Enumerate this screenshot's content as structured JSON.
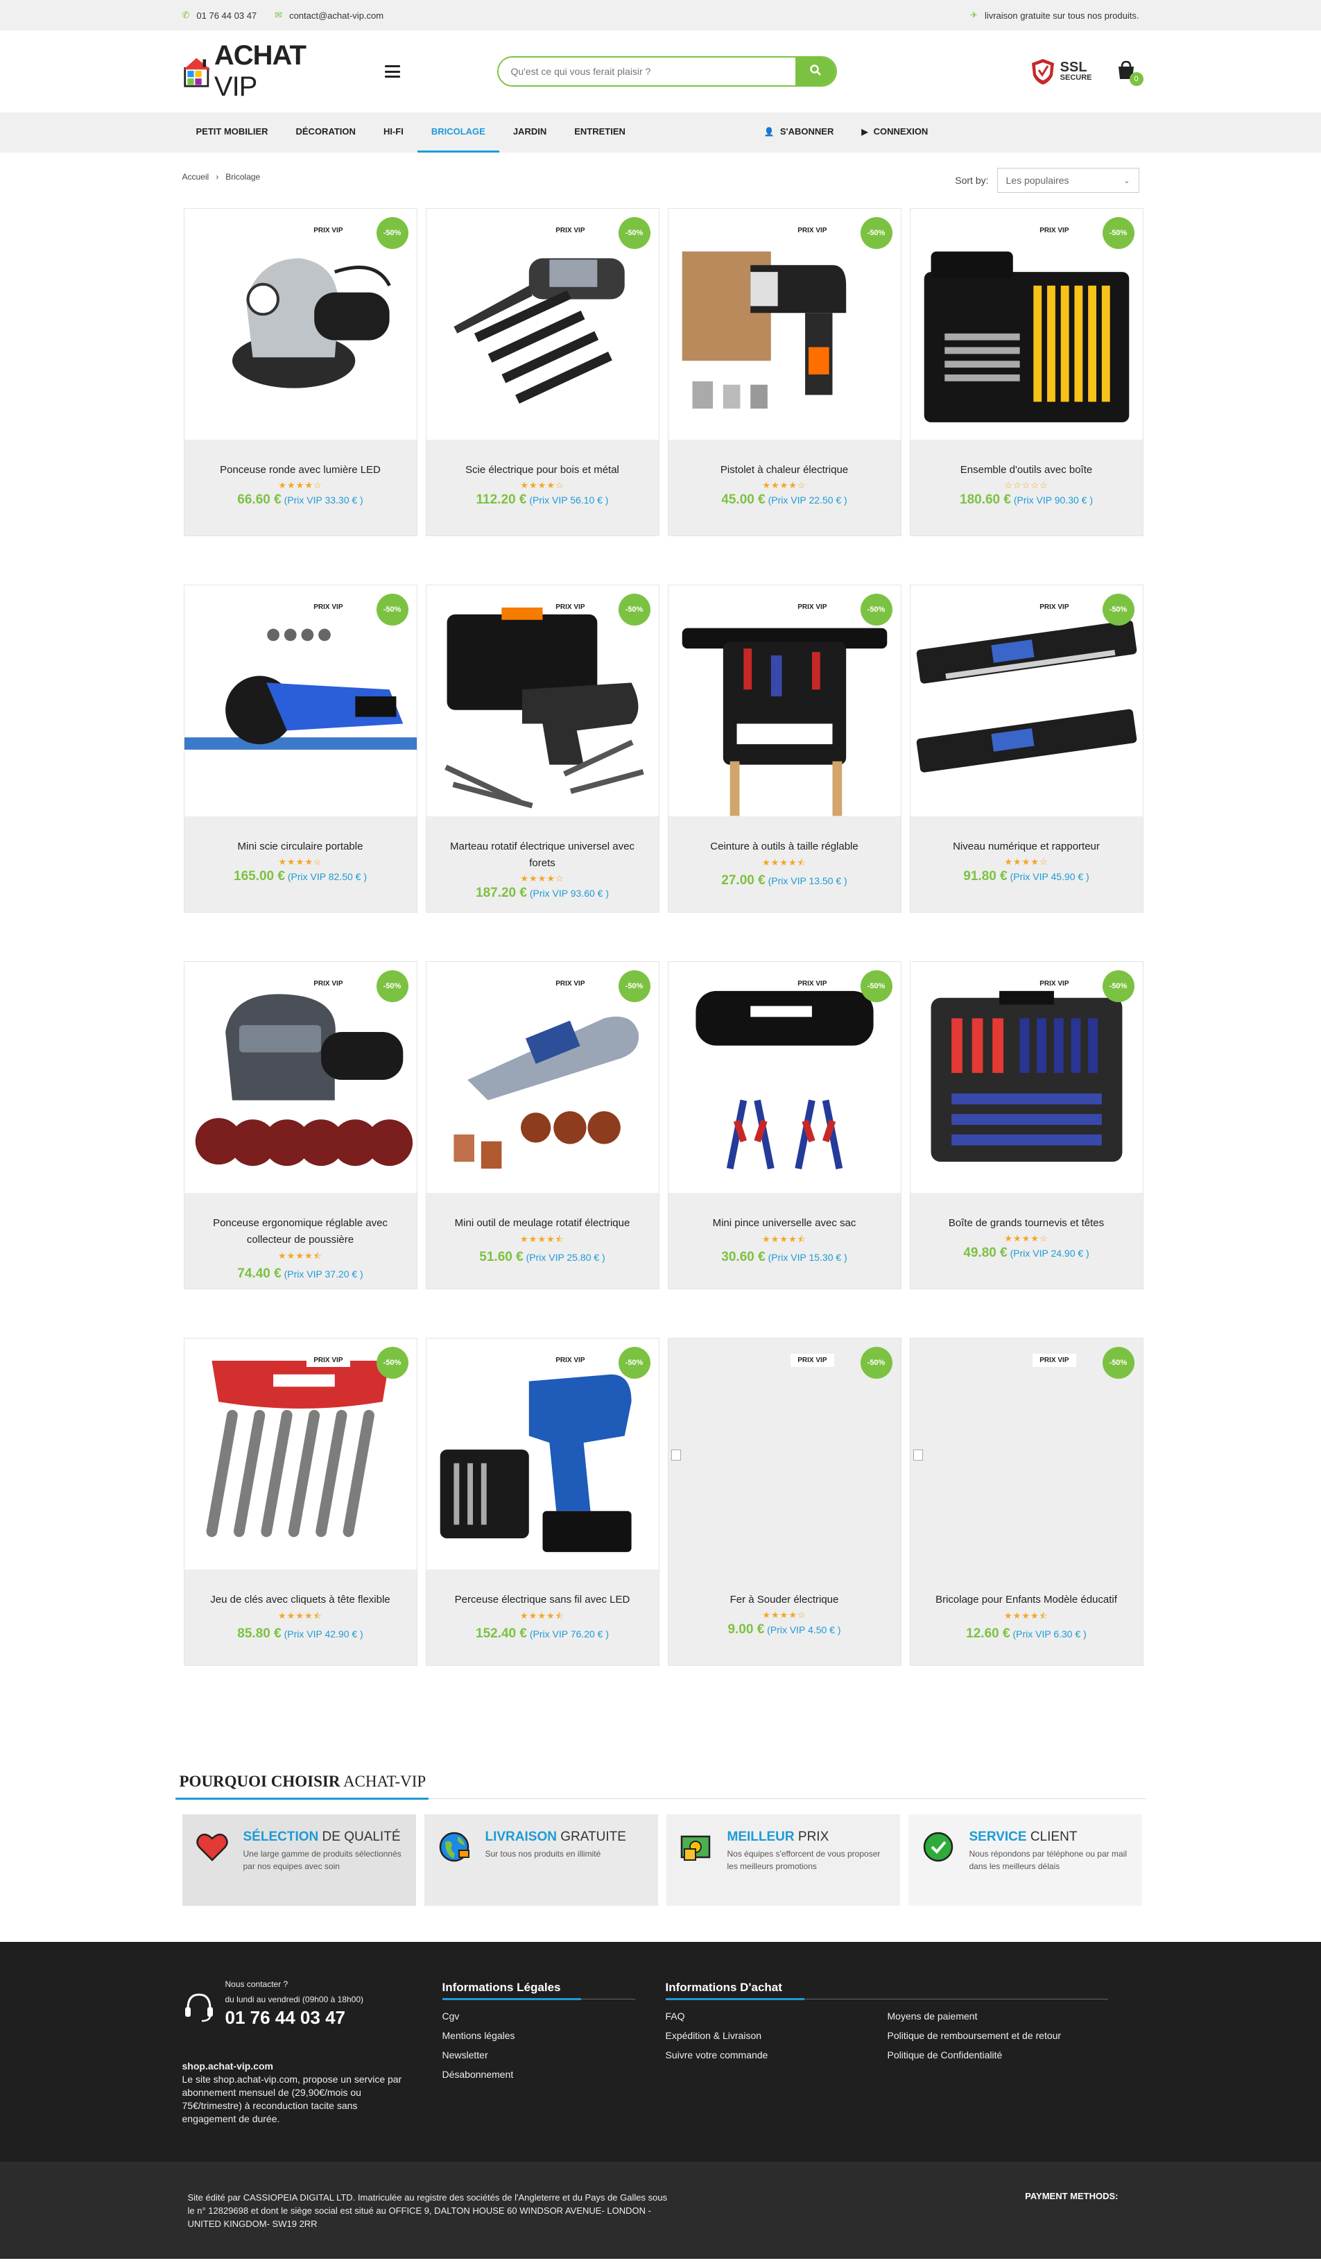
{
  "topbar": {
    "phone": "01 76 44 03 47",
    "email": "contact@achat-vip.com",
    "shipping": "livraison gratuite sur tous nos produits."
  },
  "header": {
    "logo_main": "ACHAT",
    "logo_vip": "VIP",
    "search_placeholder": "Qu'est ce qui vous ferait plaisir ?",
    "ssl_title": "SSL",
    "ssl_sub": "SECURE",
    "cart_count": "0"
  },
  "nav": {
    "items": [
      {
        "label": "PETIT MOBILIER"
      },
      {
        "label": "DÉCORATION"
      },
      {
        "label": "HI-FI"
      },
      {
        "label": "BRICOLAGE"
      },
      {
        "label": "JARDIN"
      },
      {
        "label": "ENTRETIEN"
      }
    ],
    "subscribe": "S'ABONNER",
    "login": "CONNEXION"
  },
  "breadcrumb": {
    "home": "Accueil",
    "sep": "›",
    "current": "Bricolage"
  },
  "sort": {
    "label": "Sort by:",
    "value": "Les populaires"
  },
  "badges": {
    "vip": "PRIX VIP",
    "discount": "-50%"
  },
  "products": [
    {
      "name": "Ponceuse ronde avec lumière LED",
      "rating": 4,
      "price": "66.60 €",
      "vip": "33.30 € )"
    },
    {
      "name": "Scie électrique pour bois et métal",
      "rating": 4,
      "price": "112.20 €",
      "vip": "56.10 € )"
    },
    {
      "name": "Pistolet à chaleur électrique",
      "rating": 4,
      "price": "45.00 €",
      "vip": "22.50 € )"
    },
    {
      "name": "Ensemble d'outils avec boîte",
      "rating": 0,
      "price": "180.60 €",
      "vip": "90.30 € )"
    },
    {
      "name": "Mini scie circulaire portable",
      "rating": 4,
      "price": "165.00 €",
      "vip": "82.50 € )"
    },
    {
      "name": "Marteau rotatif électrique universel avec forets",
      "rating": 4,
      "price": "187.20 €",
      "vip": "93.60 € )"
    },
    {
      "name": "Ceinture à outils à taille réglable",
      "rating": 4.5,
      "price": "27.00 €",
      "vip": "13.50 € )"
    },
    {
      "name": "Niveau numérique et rapporteur",
      "rating": 4,
      "price": "91.80 €",
      "vip": "45.90 € )"
    },
    {
      "name": "Ponceuse ergonomique réglable avec collecteur de poussière",
      "rating": 4.5,
      "price": "74.40 €",
      "vip": "37.20 € )"
    },
    {
      "name": "Mini outil de meulage rotatif électrique",
      "rating": 4.5,
      "price": "51.60 €",
      "vip": "25.80 € )"
    },
    {
      "name": "Mini pince universelle avec sac",
      "rating": 4.5,
      "price": "30.60 €",
      "vip": "15.30 € )"
    },
    {
      "name": "Boîte de grands tournevis et têtes",
      "rating": 4,
      "price": "49.80 €",
      "vip": "24.90 € )"
    },
    {
      "name": "Jeu de clés avec cliquets à tête flexible",
      "rating": 4.5,
      "price": "85.80 €",
      "vip": "42.90 € )"
    },
    {
      "name": "Perceuse électrique sans fil avec LED",
      "rating": 4.5,
      "price": "152.40 €",
      "vip": "76.20 € )"
    },
    {
      "name": "Fer à Souder électrique",
      "rating": 4,
      "price": "9.00 €",
      "vip": "4.50 € )"
    },
    {
      "name": "Bricolage pour Enfants Modèle éducatif",
      "rating": 4.5,
      "price": "12.60 €",
      "vip": "6.30 € )"
    }
  ],
  "price_vip_label": "(Prix VIP",
  "why": {
    "title_bold": "Pourquoi choisir",
    "title_rest": "ACHAT-VIP",
    "boxes": [
      {
        "hl": "SÉLECTION",
        "rest": "DE QUALITÉ",
        "desc": "Une large gamme de produits sélectionnés par nos equipes avec soin",
        "icon": "heart-icon"
      },
      {
        "hl": "LIVRAISON",
        "rest": "GRATUITE",
        "desc": "Sur tous nos produits en illimité",
        "icon": "globe-icon"
      },
      {
        "hl": "MEILLEUR",
        "rest": "PRIX",
        "desc": "Nos équipes s'efforcent de vous proposer les meilleurs promotions",
        "icon": "money-icon"
      },
      {
        "hl": "SERVICE",
        "rest": "CLIENT",
        "desc": "Nous répondons par téléphone ou par mail dans les meilleurs délais",
        "icon": "check-icon"
      }
    ]
  },
  "footer": {
    "contact_label": "Nous contacter ?",
    "hours": "du lundi au vendredi (09h00 à 18h00)",
    "phone": "01 76 44 03 47",
    "site": "shop.achat-vip.com",
    "about": "Le site shop.achat-vip.com, propose un service par abonnement mensuel de (29,90€/mois ou 75€/trimestre) à reconduction tacite sans engagement de durée.",
    "legal_title": "Informations Légales",
    "legal_links": [
      "Cgv",
      "Mentions légales",
      "Newsletter",
      "Désabonnement"
    ],
    "achat_title": "Informations D'achat",
    "achat_links_1": [
      "FAQ",
      "Expédition & Livraison",
      "Suivre votre commande"
    ],
    "achat_links_2": [
      "Moyens de paiement",
      "Politique de remboursement et de retour",
      "Politique de Confidentialité"
    ],
    "legal_text": "Site édité par CASSIOPEIA DIGITAL LTD. Imatriculée au registre des sociétés de l'Angleterre et du Pays de Galles sous le n° 12829698 et dont le siège social est situé au OFFICE 9, DALTON HOUSE 60 WINDSOR AVENUE- LONDON - UNITED KINGDOM- SW19 2RR",
    "payment": "PAYMENT METHODS:"
  },
  "colors": {
    "green": "#7cc242",
    "blue": "#1e9ad6"
  }
}
